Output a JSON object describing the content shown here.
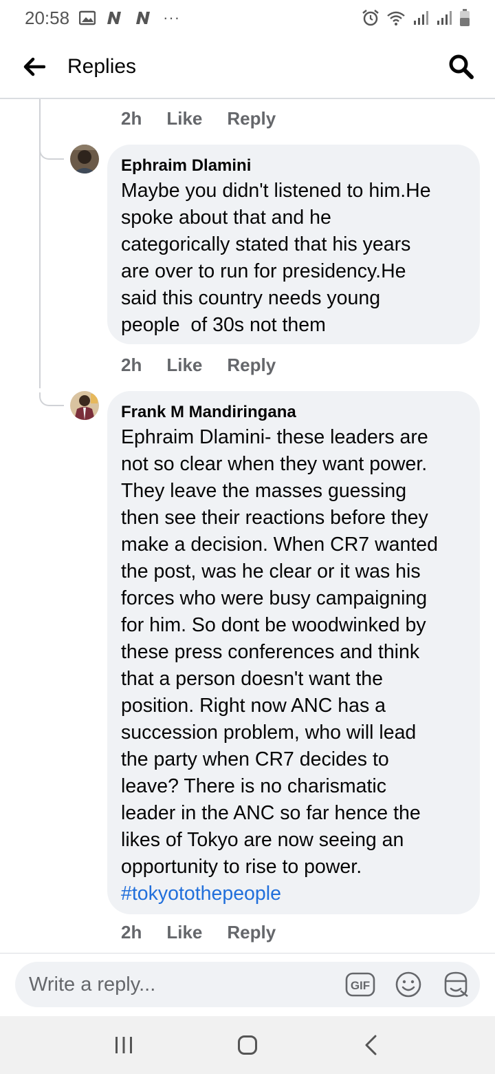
{
  "status_bar": {
    "time": "20:58",
    "ellipsis": "···"
  },
  "header": {
    "title": "Replies"
  },
  "top_actions": {
    "time": "2h",
    "like": "Like",
    "reply": "Reply"
  },
  "comments": [
    {
      "author": "Ephraim Dlamini",
      "lines": [
        "Maybe you didn't listened to him.He",
        "spoke about that and he",
        "categorically stated that his years",
        "are over to run for presidency.He",
        "said this country needs young",
        "people  of 30s not them"
      ],
      "time": "2h",
      "like": "Like",
      "reply": "Reply"
    },
    {
      "author": "Frank M Mandiringana",
      "lines": [
        "Ephraim Dlamini- these leaders are",
        "not so clear when they want power.",
        "They leave the masses guessing",
        "then see their reactions before they",
        "make a decision. When CR7 wanted",
        "the post, was he clear or it was his",
        "forces who were busy campaigning",
        "for him. So dont be woodwinked by",
        "these press conferences and think",
        "that a person doesn't want the",
        "position. Right now ANC has a",
        "succession problem, who will lead",
        "the party when CR7 decides to",
        "leave? There is no charismatic",
        "leader in the ANC so far hence the",
        "likes of Tokyo are now seeing an",
        "opportunity to rise to power."
      ],
      "hashtag": "#tokyotothepeople",
      "time": "2h",
      "like": "Like",
      "reply": "Reply"
    }
  ],
  "reply_bar": {
    "placeholder": "Write a reply...",
    "gif_label": "GIF"
  },
  "colors": {
    "bubble": "#f0f2f5",
    "meta": "#65676b",
    "link": "#216fdb",
    "thread_line": "#d0d2d6"
  }
}
